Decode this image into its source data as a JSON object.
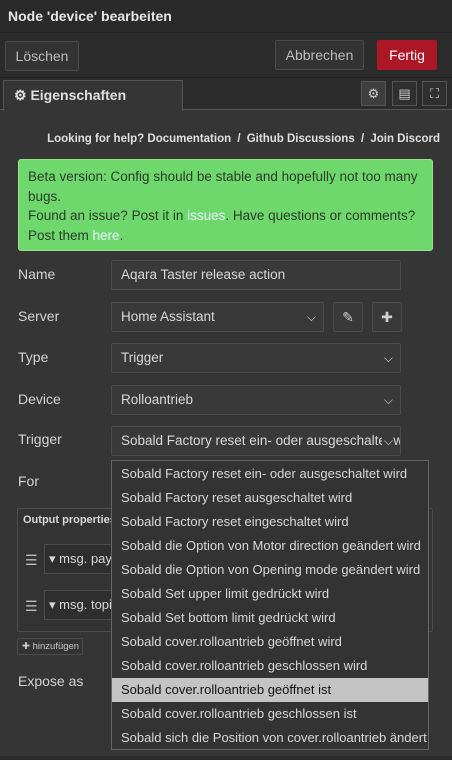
{
  "window": {
    "title": "Node 'device' bearbeiten"
  },
  "toolbar": {
    "delete": "Löschen",
    "cancel": "Abbrechen",
    "done": "Fertig"
  },
  "tabs": {
    "properties": "Eigenschaften",
    "settings_icon": "⚙",
    "desc_icon": "▤",
    "appearance_icon": "⛶"
  },
  "help": {
    "text": "Looking for help?",
    "documentation": "Documentation",
    "sep": "/",
    "github": "Github Discussions",
    "join": "Join Discord"
  },
  "beta": {
    "line1": "Beta version: Config should be stable and hopefully not too many bugs.",
    "line2a": "Found an issue? Post it in ",
    "issues": "issues",
    "line2b": ". Have questions or comments? Post them ",
    "here": "here",
    "line2c": "."
  },
  "form": {
    "name": {
      "label": "Name",
      "value": "Aqara Taster release action"
    },
    "server": {
      "label": "Server",
      "value": "Home Assistant"
    },
    "type": {
      "label": "Type",
      "value": "Trigger"
    },
    "device": {
      "label": "Device",
      "value": "Rolloantrieb"
    },
    "trigger": {
      "label": "Trigger",
      "value": "Sobald Factory reset ein- oder ausgeschaltet wird"
    },
    "for": {
      "label": "For"
    },
    "expose": {
      "label": "Expose as"
    }
  },
  "output": {
    "title": "Output properties",
    "rows": [
      {
        "prefix": "msg.",
        "value": "payload"
      },
      {
        "prefix": "msg.",
        "value": "topic"
      }
    ],
    "add": "hinzufügen"
  },
  "dropdown": {
    "selected_index": 9,
    "options": [
      "Sobald Factory reset ein- oder ausgeschaltet wird",
      "Sobald Factory reset ausgeschaltet wird",
      "Sobald Factory reset eingeschaltet wird",
      "Sobald die Option von Motor direction geändert wird",
      "Sobald die Option von Opening mode geändert wird",
      "Sobald Set upper limit gedrückt wird",
      "Sobald Set bottom limit gedrückt wird",
      "Sobald cover.rolloantrieb geöffnet wird",
      "Sobald cover.rolloantrieb geschlossen wird",
      "Sobald cover.rolloantrieb geöffnet ist",
      "Sobald cover.rolloantrieb geschlossen ist",
      "Sobald sich die Position von cover.rolloantrieb ändert"
    ]
  },
  "colors": {
    "done": "#ad1625",
    "beta_bg": "#6fd86c",
    "selected_option": "#c4c4c4"
  }
}
